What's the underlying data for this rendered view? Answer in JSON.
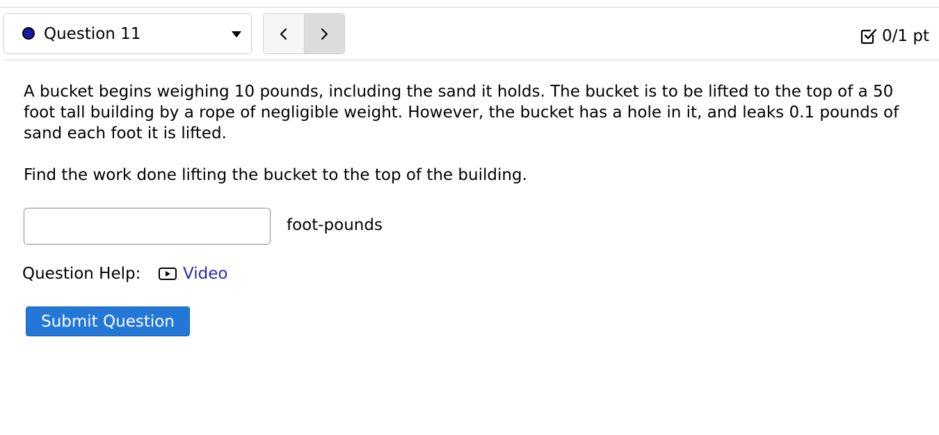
{
  "header": {
    "question_label": "Question 11",
    "status_color": "#1a1aa8",
    "dropdown_icon": "caret-down-icon",
    "prev_icon": "chevron-left-icon",
    "next_icon": "chevron-right-icon",
    "points_icon": "checkbox-checked-icon",
    "points_text": "0/1 pt"
  },
  "question": {
    "body": "A bucket begins weighing 10 pounds, including the sand it holds. The bucket is to be lifted to the top of a 50 foot tall building by a rope of negligible weight. However, the bucket has a hole in it, and leaks 0.1 pounds of sand each foot it is lifted.",
    "prompt": "Find the work done lifting the bucket to the top of the building.",
    "answer_value": "",
    "units": "foot-pounds"
  },
  "help": {
    "label": "Question Help:",
    "video_icon": "video-play-icon",
    "video_label": "Video",
    "link_color": "#2b2baa"
  },
  "actions": {
    "submit_label": "Submit Question",
    "submit_color": "#2377d6"
  }
}
